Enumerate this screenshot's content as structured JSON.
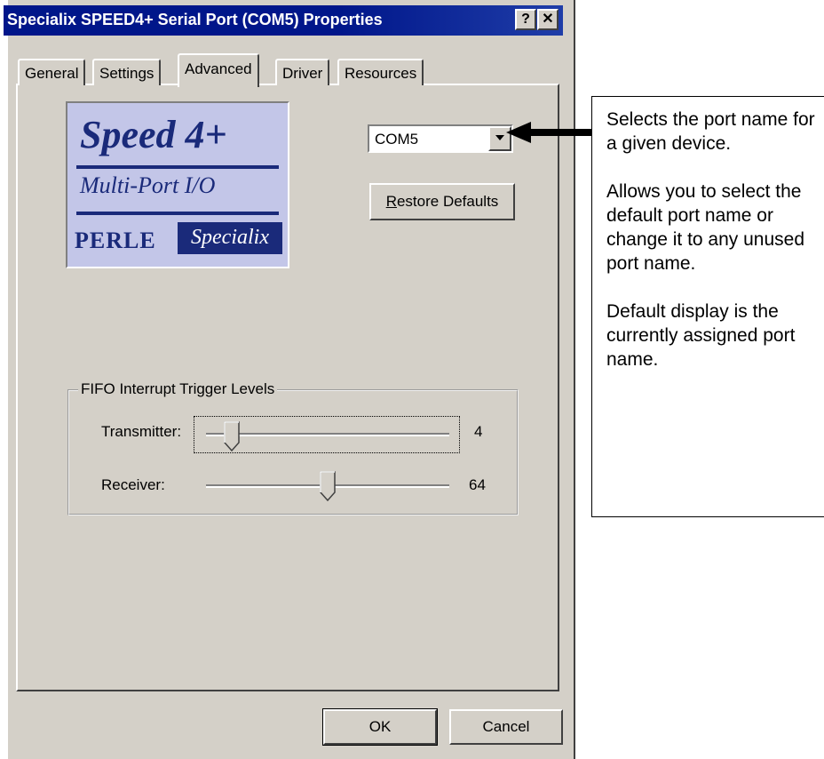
{
  "window": {
    "title": "Specialix SPEED4+ Serial Port (COM5) Properties",
    "help_glyph": "?",
    "close_glyph": "✕"
  },
  "tabs": [
    {
      "label": "General",
      "active": false
    },
    {
      "label": "Settings",
      "active": false
    },
    {
      "label": "Advanced",
      "active": true
    },
    {
      "label": "Driver",
      "active": false
    },
    {
      "label": "Resources",
      "active": false
    }
  ],
  "logo": {
    "line1": "Speed 4+",
    "line2": "Multi-Port I/O",
    "brand_left": "PERLE",
    "brand_right": "Specialix"
  },
  "port": {
    "selected": "COM5"
  },
  "restore_button": {
    "label_prefix": "R",
    "label_rest": "estore Defaults"
  },
  "fifo": {
    "group_label": "FIFO Interrupt Trigger Levels",
    "transmitter": {
      "label": "Transmitter:",
      "value": "4",
      "position_fraction": 0.08
    },
    "receiver": {
      "label": "Receiver:",
      "value": "64",
      "position_fraction": 0.5
    }
  },
  "buttons": {
    "ok": "OK",
    "cancel": "Cancel"
  },
  "callout": {
    "p1": "Selects the port name for a given device.",
    "p2": "Allows you to select the default port name or change it to any unused port name.",
    "p3": "Default display is the currently assigned port name."
  },
  "colors": {
    "titlebar": "#00168a",
    "dialog_face": "#d4d0c8",
    "logo_navy": "#1a2a7a",
    "logo_bg": "#c3c6e8"
  }
}
